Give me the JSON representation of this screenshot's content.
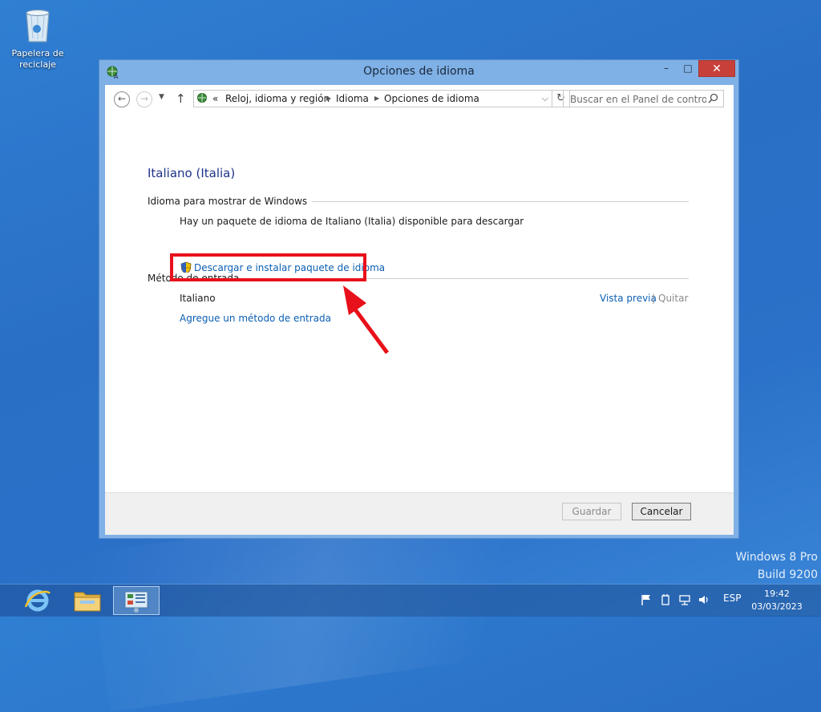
{
  "desktop": {
    "recycle_bin_label": "Papelera de reciclaje"
  },
  "window": {
    "title": "Opciones de idioma",
    "controls": {
      "minimize": "–",
      "maximize": "□",
      "close": "✕"
    }
  },
  "address_bar": {
    "prefix": "«",
    "breadcrumb": [
      "Reloj, idioma y región",
      "Idioma",
      "Opciones de idioma"
    ],
    "search_placeholder": "Buscar en el Panel de control"
  },
  "content": {
    "heading": "Italiano (Italia)",
    "display_section": {
      "header": "Idioma para mostrar de Windows",
      "notice": "Hay un paquete de idioma de Italiano (Italia) disponible para descargar",
      "download_link": "Descargar e instalar paquete de idioma"
    },
    "input_section": {
      "header": "Método de entrada",
      "method": "Italiano",
      "preview_link": "Vista previa",
      "separator": "|",
      "remove_link": "Quitar",
      "add_link": "Agregue un método de entrada"
    }
  },
  "footer": {
    "save_label": "Guardar",
    "cancel_label": "Cancelar"
  },
  "watermark": {
    "line1": "Windows 8 Pro",
    "line2": "Build 9200"
  },
  "taskbar": {
    "language": "ESP",
    "time": "19:42",
    "date": "03/03/2023"
  },
  "colors": {
    "accent_link": "#0b5fb2",
    "heading": "#1e3287",
    "highlight": "#e8101a",
    "close_button": "#c7413a"
  }
}
